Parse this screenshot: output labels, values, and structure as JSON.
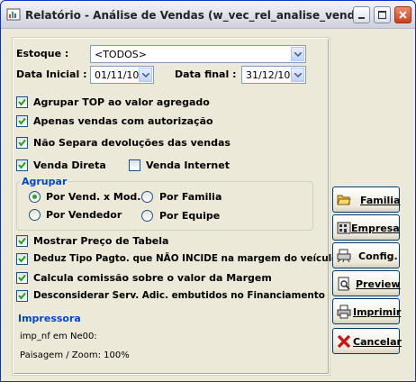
{
  "window": {
    "title": "Relatório - Análise de Vendas (w_vec_rel_analise_venda)"
  },
  "form": {
    "estoque_label": "Estoque :",
    "estoque_value": "<TODOS>",
    "data_inicial_label": "Data Inicial :",
    "data_inicial_value": "01/11/10",
    "data_final_label": "Data final :",
    "data_final_value": "31/12/10"
  },
  "options": [
    {
      "label": "Agrupar TOP ao valor agregado",
      "checked": true
    },
    {
      "label": "Apenas vendas com autorização",
      "checked": true
    },
    {
      "label": "Não Separa devoluções das vendas",
      "checked": true
    }
  ],
  "venda": {
    "direta_label": "Venda Direta",
    "direta_checked": true,
    "internet_label": "Venda Internet",
    "internet_checked": false
  },
  "agrupar": {
    "title": "Agrupar",
    "radios": [
      {
        "label": "Por Vend. x Mod.",
        "selected": true
      },
      {
        "label": "Por Familia",
        "selected": false
      },
      {
        "label": "Por Vendedor",
        "selected": false
      },
      {
        "label": "Por Equipe",
        "selected": false
      }
    ]
  },
  "options2": [
    {
      "label": "Mostrar Preço de Tabela",
      "checked": true
    },
    {
      "label": "Deduz Tipo Pagto. que NÃO INCIDE na margem do veículo",
      "checked": true
    },
    {
      "label": "Calcula comissão sobre o valor da Margem",
      "checked": true
    },
    {
      "label": "Desconsiderar Serv. Adic. embutidos no Financiamento",
      "checked": true
    }
  ],
  "impressora": {
    "title": "Impressora",
    "printer": "imp_nf em Ne00:",
    "layout": "Paisagem / Zoom: 100%"
  },
  "buttons": {
    "familia": "Familia",
    "empresa": "Empresa",
    "config": "Config.",
    "preview": "Preview",
    "imprimir": "Imprimir",
    "cancelar": "Cancelar"
  },
  "colors": {
    "group_title": "#0046d5",
    "check": "#21a121",
    "titlebar_close": "#c9401c"
  }
}
